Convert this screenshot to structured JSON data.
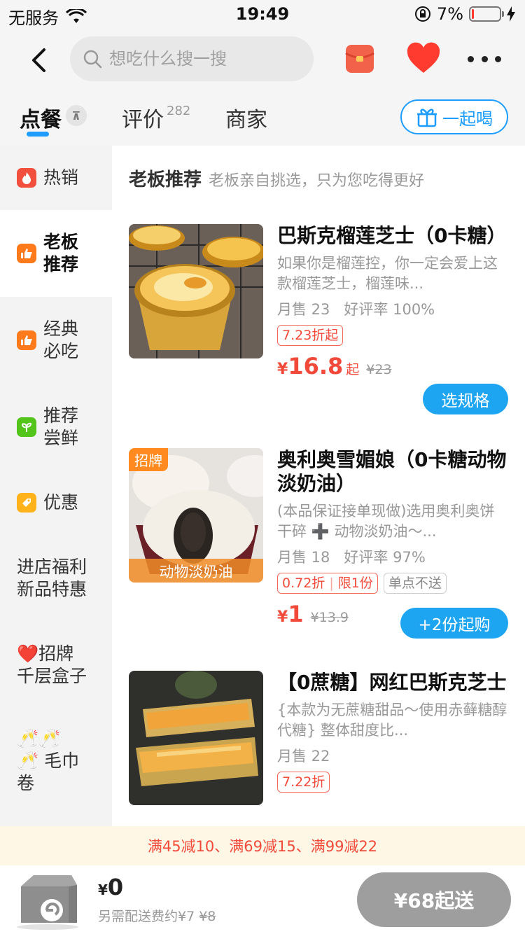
{
  "status_bar": {
    "carrier": "无服务",
    "time": "19:49",
    "battery_percent": "7%",
    "battery_level": 0.07,
    "icons": [
      "wifi-icon",
      "rotation-lock-icon",
      "battery-icon",
      "charging-icon"
    ]
  },
  "header": {
    "search_placeholder": "想吃什么搜一搜",
    "icons": [
      "back-icon",
      "search-icon",
      "red-envelope-icon",
      "heart-icon",
      "more-icon"
    ]
  },
  "tabs": {
    "order_label": "点餐",
    "reviews_label": "评价",
    "reviews_count": "282",
    "merchant_label": "商家",
    "together_label": "一起喝"
  },
  "sidebar": {
    "items": [
      {
        "label": "热销",
        "icon": "fire-icon"
      },
      {
        "label": "老板\n推荐",
        "icon": "thumb-up-icon"
      },
      {
        "label": "经典\n必吃",
        "icon": "thumb-up-icon"
      },
      {
        "label": "推荐\n尝鲜",
        "icon": "sprout-icon"
      },
      {
        "label": "优惠",
        "icon": "tag-icon"
      },
      {
        "label": "进店福利\n新品特惠",
        "icon": ""
      },
      {
        "label": "❤️招牌\n千层盒子",
        "icon": ""
      },
      {
        "label": "🥂🥂\n🥂 毛巾\n卷",
        "icon": ""
      }
    ]
  },
  "section": {
    "title": "老板推荐",
    "subtitle": "老板亲自挑选，只为您吃得更好"
  },
  "products": [
    {
      "name": "巴斯克榴莲芝士（0卡糖）",
      "desc": "如果你是榴莲控，你一定会爱上这款榴莲芝士，榴莲味...",
      "stats": "月售 23   好评率 100%",
      "tag1": "7.23折起",
      "price_yen": "¥",
      "price": "16.8",
      "price_suffix": "起",
      "old_price": "¥23",
      "action": "选规格"
    },
    {
      "badge": "招牌",
      "img_caption": "动物淡奶油",
      "name": "奥利奥雪媚娘（0卡糖动物淡奶油）",
      "desc": "(本品保证接单现做)选用奥利奥饼干碎 ➕ 动物淡奶油～...",
      "stats": "月售 18   好评率 97%",
      "tag1": "0.72折",
      "tag1b": "限1份",
      "tag2": "单点不送",
      "price_yen": "¥",
      "price": "1",
      "old_price": "¥13.9",
      "action": "+2份起购"
    },
    {
      "name": "【0蔗糖】网红巴斯克芝士",
      "desc": "{本款为无蔗糖甜品～使用赤藓糖醇代糖} 整体甜度比...",
      "stats": "月售 22",
      "tag1": "7.22折"
    }
  ],
  "promo": {
    "text": "满45减10、满69减15、满99减22"
  },
  "cart": {
    "total_yen": "¥",
    "total": "0",
    "fee_text": "另需配送费约¥7",
    "fee_old": "¥8",
    "checkout_label": "¥68起送"
  },
  "colors": {
    "accent_blue": "#1ea5f2",
    "price_red": "#f24a3a",
    "badge_orange": "#ff8a1f",
    "promo_bg": "#fff7e6"
  }
}
